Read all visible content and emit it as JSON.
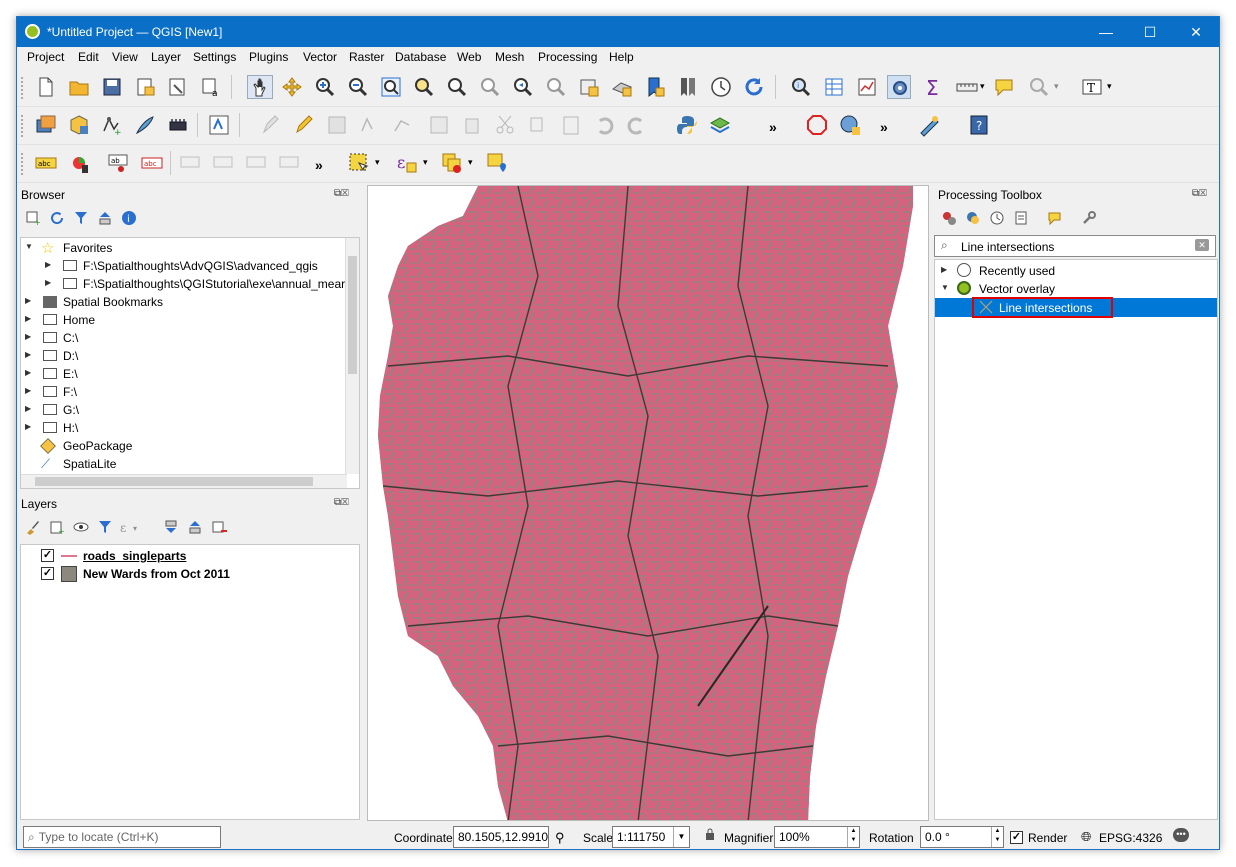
{
  "window": {
    "title": "*Untitled Project — QGIS [New1]",
    "minimize": "—",
    "maximize": "☐",
    "close": "✕"
  },
  "menu": [
    "Project",
    "Edit",
    "View",
    "Layer",
    "Settings",
    "Plugins",
    "Vector",
    "Raster",
    "Database",
    "Web",
    "Mesh",
    "Processing",
    "Help"
  ],
  "overflow_chevron": "»",
  "browser": {
    "title": "Browser",
    "items": [
      {
        "label": "Favorites",
        "icon": "star-icon"
      },
      {
        "label": "F:\\Spatialthoughts\\AdvQGIS\\advanced_qgis",
        "icon": "folder-icon"
      },
      {
        "label": "F:\\Spatialthoughts\\QGIStutorial\\exe\\annual_mear",
        "icon": "folder-icon"
      },
      {
        "label": "Spatial Bookmarks",
        "icon": "bookmark-icon"
      },
      {
        "label": "Home",
        "icon": "home-icon"
      },
      {
        "label": "C:\\",
        "icon": "folder-icon"
      },
      {
        "label": "D:\\",
        "icon": "folder-icon"
      },
      {
        "label": "E:\\",
        "icon": "folder-icon"
      },
      {
        "label": "F:\\",
        "icon": "folder-icon"
      },
      {
        "label": "G:\\",
        "icon": "folder-icon"
      },
      {
        "label": "H:\\",
        "icon": "folder-icon"
      },
      {
        "label": "GeoPackage",
        "icon": "geopackage-icon"
      },
      {
        "label": "SpatiaLite",
        "icon": "spatialite-icon"
      }
    ]
  },
  "layers": {
    "title": "Layers",
    "items": [
      {
        "label": "roads_singleparts",
        "checked": true,
        "symbol_color": "#e0758f",
        "symbol": "line"
      },
      {
        "label": "New Wards from Oct 2011",
        "checked": true,
        "symbol_color": "#8c887e",
        "symbol": "fill"
      }
    ]
  },
  "map": {
    "polygon_fill": "#8c887e",
    "road_color": "#d9607f"
  },
  "toolbox": {
    "title": "Processing Toolbox",
    "search_value": "Line intersections",
    "tree": [
      {
        "label": "Recently used",
        "icon": "clock-icon"
      },
      {
        "label": "Vector overlay",
        "icon": "qgis-icon"
      },
      {
        "label": "Line intersections",
        "icon": "line-intersections-icon",
        "selected": true
      }
    ],
    "highlight_color": "#e00000",
    "selection_color": "#0078d7"
  },
  "status": {
    "locate_placeholder": "Type to locate (Ctrl+K)",
    "coordinate_label": "Coordinate",
    "coordinate_value": "80.1505,12.9910",
    "scale_label": "Scale",
    "scale_value": "1:111750",
    "magnifier_label": "Magnifier",
    "magnifier_value": "100%",
    "rotation_label": "Rotation",
    "rotation_value": "0.0 °",
    "render_label": "Render",
    "crs": "EPSG:4326"
  }
}
